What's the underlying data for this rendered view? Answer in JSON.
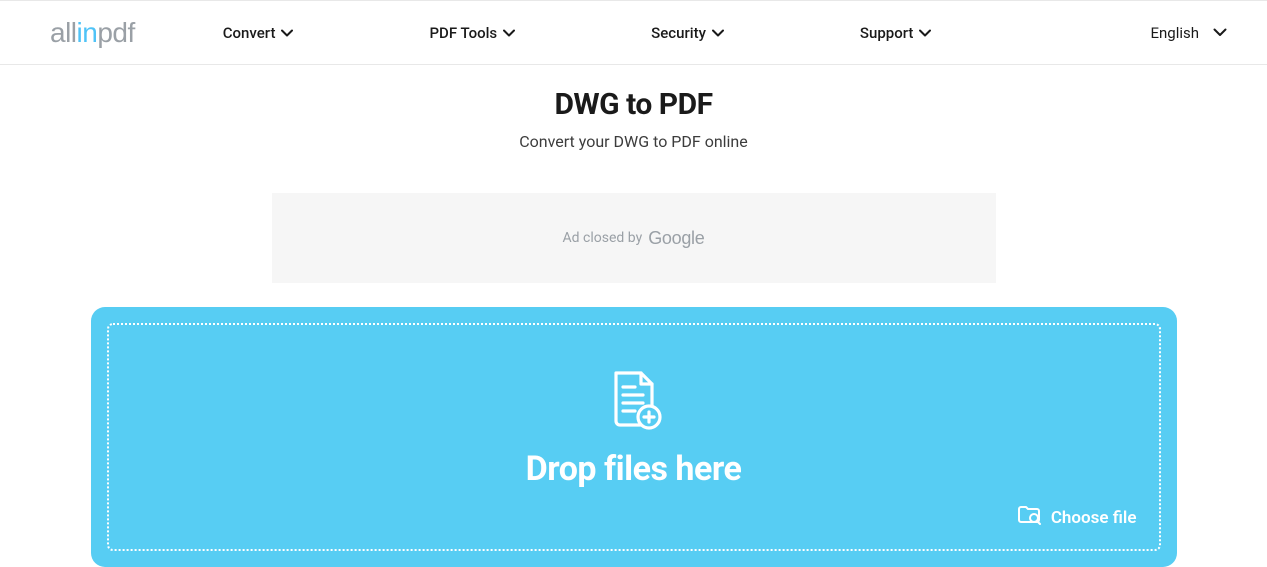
{
  "logo": {
    "part1": "all",
    "part2": "in",
    "part3": "pdf"
  },
  "nav": {
    "items": [
      {
        "label": "Convert"
      },
      {
        "label": "PDF Tools"
      },
      {
        "label": "Security"
      },
      {
        "label": "Support"
      }
    ]
  },
  "language": {
    "label": "English"
  },
  "page": {
    "title": "DWG to PDF",
    "subtitle": "Convert your DWG to PDF online"
  },
  "ad": {
    "text": "Ad closed by",
    "brand": "Google"
  },
  "dropzone": {
    "label": "Drop files here",
    "choose_label": "Choose file"
  }
}
